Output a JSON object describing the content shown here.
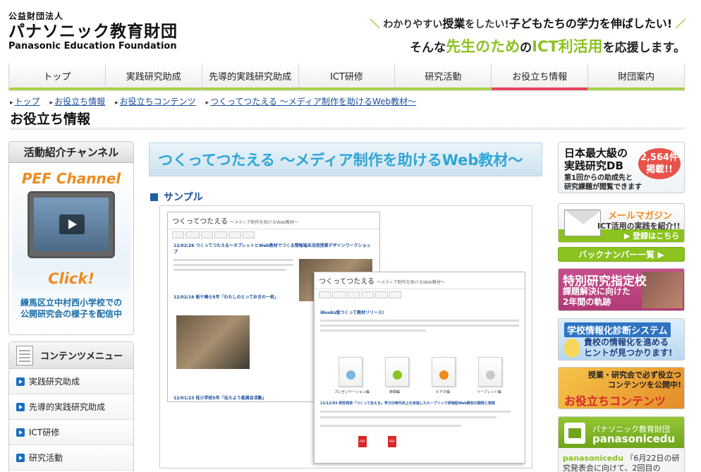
{
  "header": {
    "org_small": "公益財団法人",
    "org_large": "パナソニック教育財団",
    "org_en": "Panasonic Education Foundation",
    "tagline1_a": "わかりやすい",
    "tagline1_b": "授業",
    "tagline1_c": "をしたい!",
    "tagline1_d": "子どもたちの学力を伸ばしたい!",
    "tagline2_a": "そんな",
    "tagline2_b": "先生のため",
    "tagline2_c": "の",
    "tagline2_d": "ICT利活用",
    "tagline2_e": "を応援します。"
  },
  "nav": {
    "items": [
      "トップ",
      "実践研究助成",
      "先導的実践研究助成",
      "ICT研修",
      "研究活動",
      "お役立ち情報",
      "財団案内"
    ]
  },
  "breadcrumb": [
    "トップ",
    "お役立ち情報",
    "お役立ちコンテンツ",
    "つくってつたえる 〜メディア制作を助けるWeb教材〜"
  ],
  "page_title": "お役立ち情報",
  "left": {
    "channel_head": "活動紹介チャンネル",
    "pef": "PEF Channel",
    "click": "Click!",
    "desc_line1": "練馬区立中村西小学校での",
    "desc_line2": "公開研究会の様子を配信中",
    "menu_head": "コンテンツメニュー",
    "menu_items": [
      "実践研究助成",
      "先導的実践研究助成",
      "ICT研修",
      "研究活動"
    ]
  },
  "main": {
    "title": "つくってつたえる 〜メディア制作を助けるWeb教材〜",
    "sample_label": "サンプル",
    "shot1": {
      "title": "つくってつたえる",
      "subtitle": "〜メディア制作を助けるWeb教材〜",
      "link1": "12/02/26 つくってつたえる〜タブレットとWeb教材でつくる情報端末活用授業デザインワークショップ",
      "link2": "12/02/16 板ケ崎小5年「わたしのとっておきの一枚」",
      "link3": "12/01/23 桂小学校5年「伝えよう委員会活動」"
    },
    "shot2": {
      "title": "つくってつたえる",
      "subtitle": "〜メディア制作を助けるWeb教材〜",
      "link1": "iBooks版つくって教材リリース!",
      "book_captions": [
        "プレゼンテーション編",
        "新聞編",
        "ビデオ編",
        "リーフレット編"
      ],
      "link2": "11/12/03 研究発表「つくって伝える」学びの時代向上を目指したルーブリック評価型Web教材の開発と実践"
    }
  },
  "right": {
    "db_line1": "日本最大級の",
    "db_line2": "実践研究DB",
    "db_badge1": "2,564件",
    "db_badge2": "掲載!!",
    "db_small1": "第1回からの助成先と",
    "db_small2": "研究課題が閲覧できます",
    "mail_title": "メールマガジン",
    "mail_sub": "ICT活用の実践を紹介!!",
    "mail_btn": "▶ 登録はこちら",
    "backnumber": "バックナンバー一覧 ▶",
    "special_title": "特別研究指定校",
    "special_sub1": "課題解決に向けた",
    "special_sub2": "2年間の軌跡",
    "diag_title": "学校情報化診断システム",
    "diag_sub1": "貴校の情報化を進める",
    "diag_sub2": "ヒントが見つかります!",
    "useful_sub1": "授業・研究会で必ず役立つ",
    "useful_sub2": "コンテンツを公開中!",
    "useful_title": "お役立ちコンテンツ",
    "tw_name": "パナソニック教育財団",
    "tw_handle": "panasonicedu",
    "tw_user": "panasonicedu",
    "tw_text": "『6月22日の研究発表会に向けて、2回目の"
  },
  "colors": {
    "accent_green": "#8bc220",
    "active_red": "#e8455e",
    "link_blue": "#1a4e9b",
    "title_cyan": "#2ea6d6"
  }
}
